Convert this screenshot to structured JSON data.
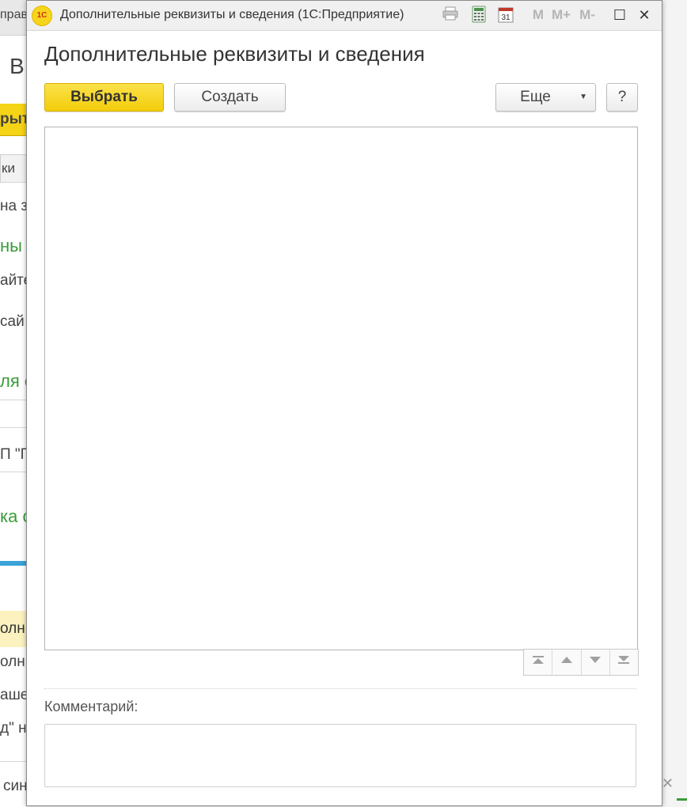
{
  "background_window": {
    "title_fragment": "прав",
    "heading_fragment": "В",
    "button_fragment": "рыт",
    "tab_fragment": "ки",
    "lines": [
      "на з",
      "ны",
      "айте",
      "сай",
      "ля с",
      "П \"Г",
      "ка с",
      "олнит",
      "олнит",
      "ашеі",
      "д\" не",
      "син"
    ]
  },
  "window": {
    "title": "Дополнительные реквизиты и сведения  (1С:Предприятие)",
    "logo_text": "1C",
    "toolbar_icons": [
      "printer-icon",
      "calculator-icon",
      "calendar-icon"
    ],
    "calendar_day": "31",
    "memory": {
      "m": "M",
      "m_plus": "M+",
      "m_minus": "M-"
    },
    "controls": {
      "maximize": "☐",
      "close": "✕"
    }
  },
  "form": {
    "title": "Дополнительные реквизиты и сведения",
    "buttons": {
      "select": "Выбрать",
      "create": "Создать",
      "more": "Еще",
      "help": "?"
    },
    "nav_buttons": [
      "first",
      "up",
      "down",
      "last"
    ],
    "comment_label": "Комментарий:",
    "comment_value": ""
  },
  "colors": {
    "primary_button": "#f3cc0b",
    "accent_green": "#3a9b3a",
    "accent_blue": "#3aa3d8"
  }
}
